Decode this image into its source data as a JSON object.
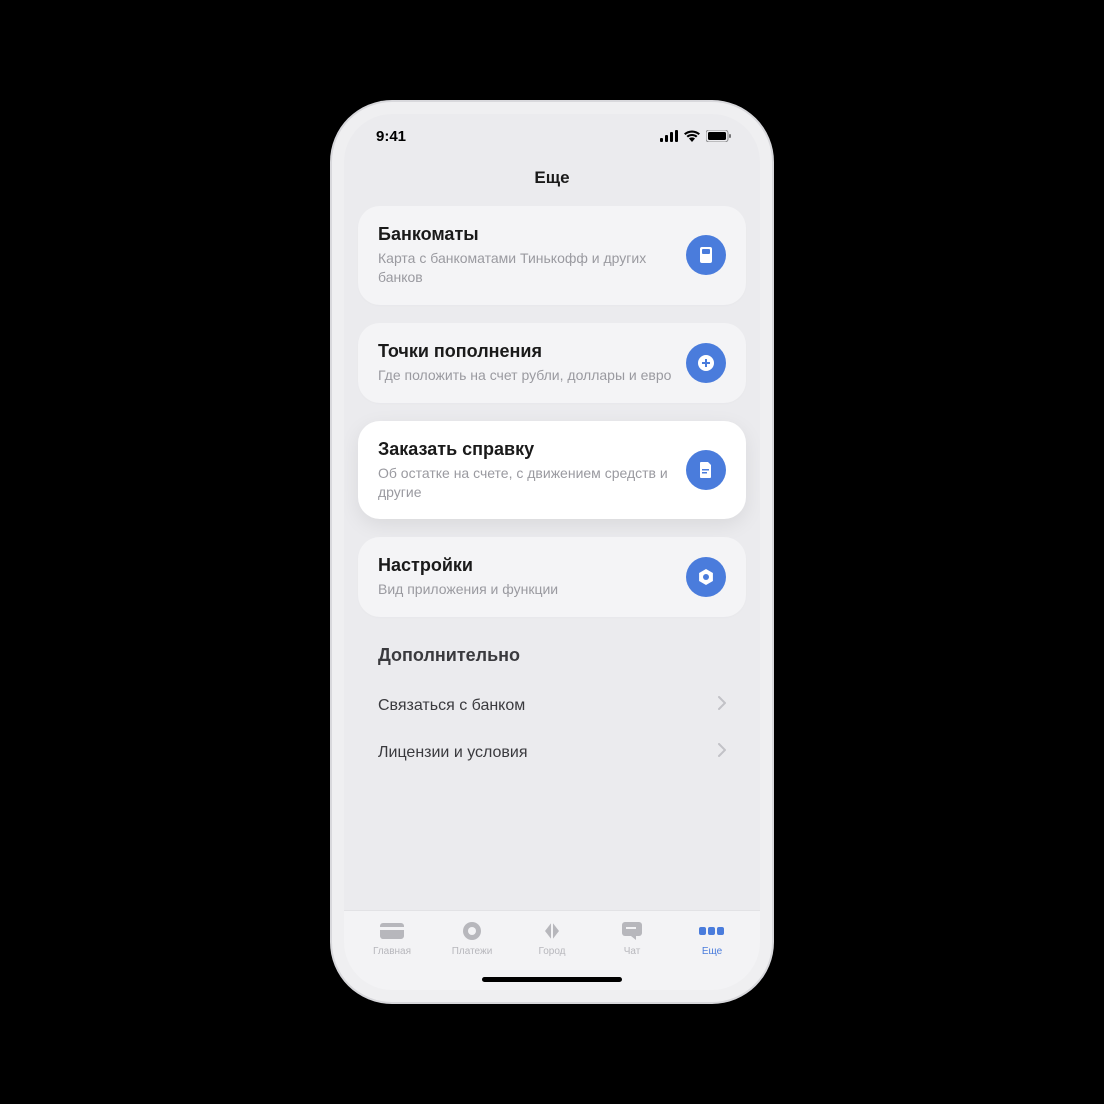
{
  "status": {
    "time": "9:41"
  },
  "page": {
    "title": "Еще"
  },
  "cards": [
    {
      "title": "Банкоматы",
      "subtitle": "Карта с банкоматами Тинькофф и других банков"
    },
    {
      "title": "Точки пополнения",
      "subtitle": "Где положить на счет рубли, доллары и евро"
    },
    {
      "title": "Заказать справку",
      "subtitle": "Об остатке на счете, с движением средств и другие"
    },
    {
      "title": "Настройки",
      "subtitle": "Вид приложения и функции"
    }
  ],
  "section": {
    "title": "Дополнительно",
    "items": [
      "Связаться с банком",
      "Лицензии и условия"
    ]
  },
  "tabs": {
    "home": "Главная",
    "payments": "Платежи",
    "city": "Город",
    "chat": "Чат",
    "more": "Еще"
  }
}
